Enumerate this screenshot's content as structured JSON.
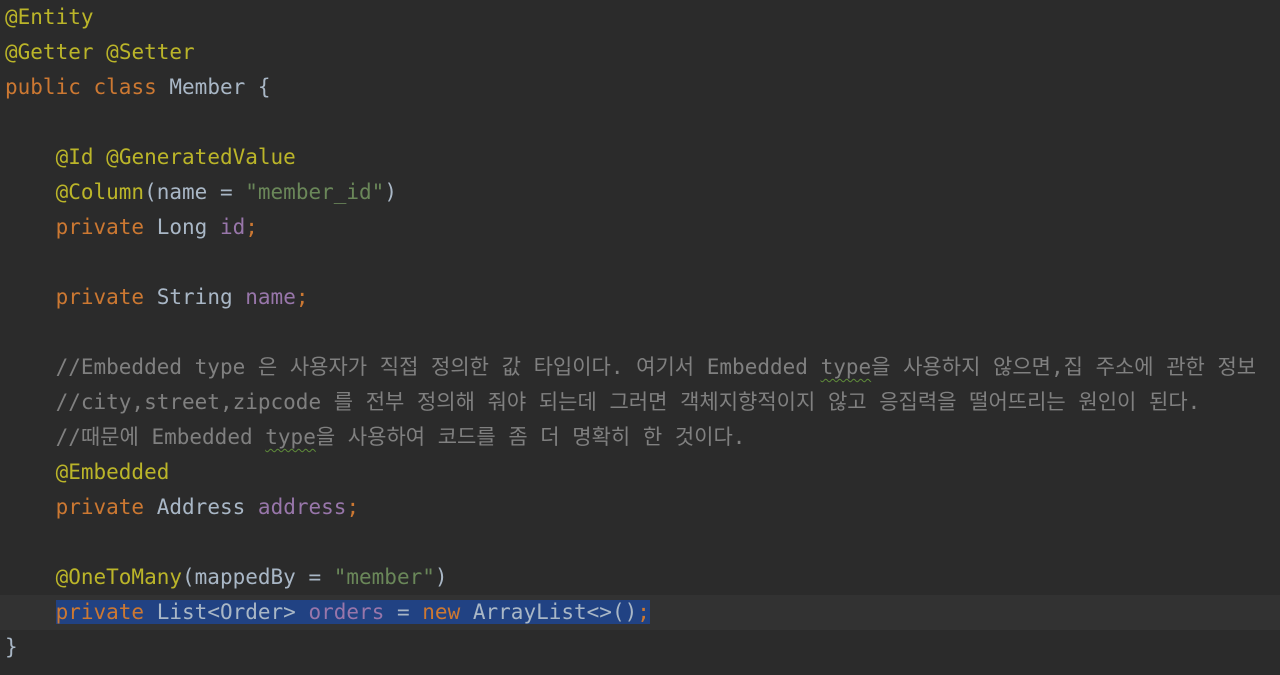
{
  "editor": {
    "lines": [
      {
        "annotation": "@Entity"
      },
      {
        "annotation_a": "@Getter",
        "space": " ",
        "annotation_b": "@Setter"
      },
      {
        "kw_public": "public",
        "kw_class": "class",
        "class_name": "Member",
        "brace": "{"
      },
      {},
      {
        "indent": "    ",
        "annotation_a": "@Id",
        "annotation_b": "@GeneratedValue"
      },
      {
        "indent": "    ",
        "annotation": "@Column",
        "args_open": "(name = ",
        "string": "\"member_id\"",
        "args_close": ")"
      },
      {
        "indent": "    ",
        "kw": "private",
        "type": "Long",
        "field": "id",
        "semi": ";"
      },
      {},
      {
        "indent": "    ",
        "kw": "private",
        "type": "String",
        "field": "name",
        "semi": ";"
      },
      {},
      {
        "indent": "    ",
        "comment_a": "//Embedded type 은 사용자가 직접 정의한 값 타입이다. 여기서 Embedded ",
        "comment_typo": "type",
        "comment_b": "을 사용하지 않으면,집 주소에 관한 정보"
      },
      {
        "indent": "    ",
        "comment": "//city,street,zipcode 를 전부 정의해 줘야 되는데 그러면 객체지향적이지 않고 응집력을 떨어뜨리는 원인이 된다."
      },
      {
        "indent": "    ",
        "comment_a": "//때문에 Embedded ",
        "comment_typo": "type",
        "comment_b": "을 사용하여 코드를 좀 더 명확히 한 것이다."
      },
      {
        "indent": "    ",
        "annotation": "@Embedded"
      },
      {
        "indent": "    ",
        "kw": "private",
        "type": "Address",
        "field": "address",
        "semi": ";"
      },
      {},
      {
        "indent": "    ",
        "annotation": "@OneToMany",
        "args_open": "(mappedBy = ",
        "string": "\"member\"",
        "args_close": ")"
      },
      {
        "indent": "    ",
        "kw": "private",
        "type": "List<Order>",
        "field": "orders",
        "assign": " = ",
        "kw_new": "new",
        "ctor": "ArrayList<>()",
        "semi": ";"
      },
      {
        "brace": "}"
      }
    ]
  },
  "colors": {
    "background": "#2b2b2b",
    "current_line": "#323232",
    "selection": "#214283",
    "annotation": "#bbb529",
    "keyword": "#cc7832",
    "identifier": "#a9b7c6",
    "field": "#9876aa",
    "string": "#6a8759",
    "comment": "#808080"
  }
}
